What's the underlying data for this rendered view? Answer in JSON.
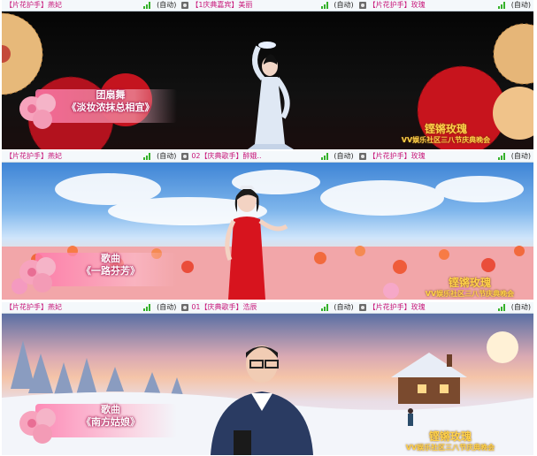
{
  "frames": [
    {
      "bar": [
        {
          "title": "【片花护手】燕妃",
          "auto": "(自动)"
        },
        {
          "title": "【1庆典嘉宾】美丽",
          "auto": "(自动)"
        },
        {
          "title": "【片花护手】玫瑰",
          "auto": "(自动)"
        }
      ],
      "caption": {
        "line1": "团扇舞",
        "line2": "《淡妆浓抹总相宜》"
      },
      "watermark": {
        "title": "铿锵玫瑰",
        "subtitle": "VV娱乐社区三八节庆典晚会"
      }
    },
    {
      "bar": [
        {
          "title": "【片花护手】燕妃",
          "auto": "(自动)"
        },
        {
          "title": "02【庆典歌手】醉娥..",
          "auto": "(自动)"
        },
        {
          "title": "【片花护手】玫瑰",
          "auto": "(自动)"
        }
      ],
      "caption": {
        "line1": "歌曲",
        "line2": "《一路芬芳》"
      },
      "watermark": {
        "title": "铿锵玫瑰",
        "subtitle": "VV娱乐社区三八节庆典晚会"
      }
    },
    {
      "bar": [
        {
          "title": "【片花护手】燕妃",
          "auto": "(自动)"
        },
        {
          "title": "01【庆典歌手】浩辰",
          "auto": "(自动)"
        },
        {
          "title": "【片花护手】玫瑰",
          "auto": "(自动)"
        }
      ],
      "caption": {
        "line1": "歌曲",
        "line2": "《南方姑娘》"
      },
      "watermark": {
        "title": "铿锵玫瑰",
        "subtitle": "VV娱乐社区三八节庆典晚会"
      }
    }
  ],
  "colors": {
    "accent": "#c8177a",
    "signal": "#35b12a",
    "watermark": "#ffd24a"
  }
}
